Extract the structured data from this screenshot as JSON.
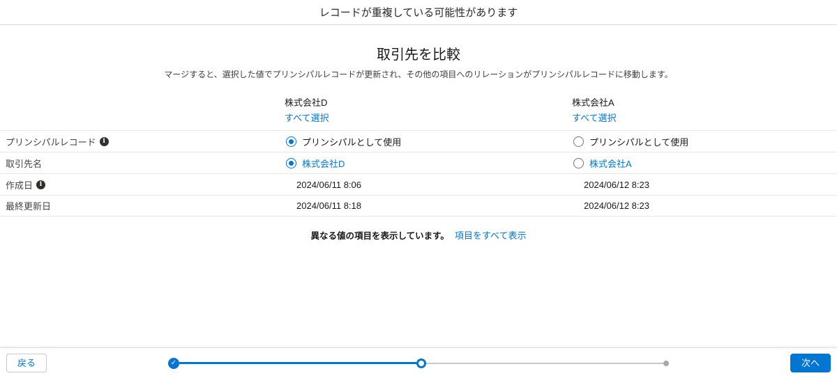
{
  "header": {
    "title": "レコードが重複している可能性があります"
  },
  "compare": {
    "title": "取引先を比較",
    "subtitle": "マージすると、選択した値でプリンシパルレコードが更新され、その他の項目へのリレーションがプリンシパルレコードに移動します。",
    "columns": [
      {
        "name": "株式会社D",
        "select_all": "すべて選択"
      },
      {
        "name": "株式会社A",
        "select_all": "すべて選択"
      }
    ],
    "rows": [
      {
        "label": "プリンシパルレコード",
        "has_info": true,
        "left": {
          "checked": true,
          "value": "プリンシパルとして使用"
        },
        "right": {
          "checked": false,
          "value": "プリンシパルとして使用"
        }
      },
      {
        "label": "取引先名",
        "has_info": false,
        "left": {
          "checked": true,
          "value": "株式会社D"
        },
        "right": {
          "checked": false,
          "value": "株式会社A"
        }
      },
      {
        "label": "作成日",
        "has_info": true,
        "left": {
          "value": "2024/06/11 8:06"
        },
        "right": {
          "value": "2024/06/12 8:23"
        }
      },
      {
        "label": "最終更新日",
        "has_info": false,
        "left": {
          "value": "2024/06/11 8:18"
        },
        "right": {
          "value": "2024/06/12 8:23"
        }
      }
    ],
    "footer_note": "異なる値の項目を表示しています。",
    "show_all_link": "項目をすべて表示"
  },
  "footer": {
    "back_label": "戻る",
    "next_label": "次へ"
  },
  "icons": {
    "info": "i",
    "check": "✓"
  },
  "colors": {
    "accent": "#0176d3"
  }
}
